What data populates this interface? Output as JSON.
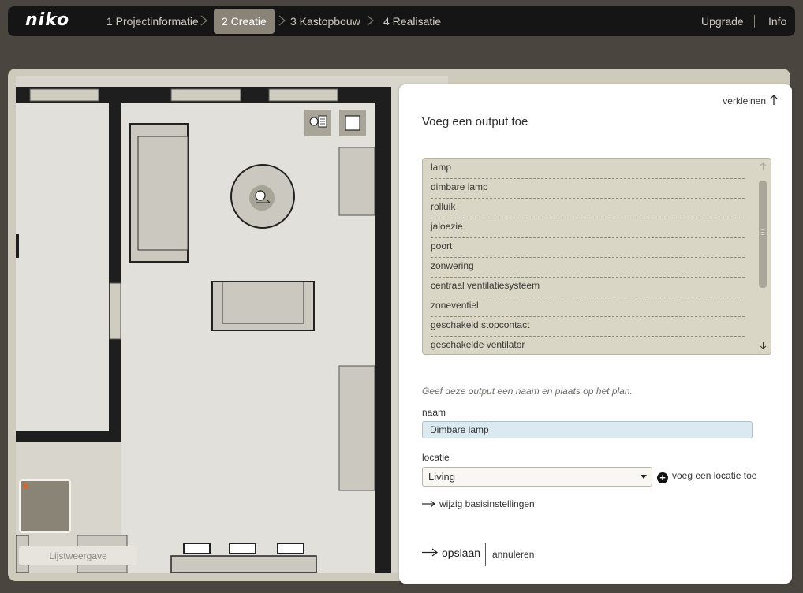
{
  "brand": {
    "logo": "niko"
  },
  "steps": [
    {
      "label": "1 Projectinformatie",
      "active": false
    },
    {
      "label": "2 Creatie",
      "active": true
    },
    {
      "label": "3 Kastopbouw",
      "active": false
    },
    {
      "label": "4 Realisatie",
      "active": false
    }
  ],
  "topnav": {
    "upgrade": "Upgrade",
    "info": "Info"
  },
  "plan": {
    "list_view_button": "Lijstweergave"
  },
  "panel": {
    "collapse_label": "verkleinen",
    "title": "Voeg een output toe",
    "output_types": [
      "lamp",
      "dimbare lamp",
      "rolluik",
      "jaloezie",
      "poort",
      "zonwering",
      "centraal ventilatiesysteem",
      "zoneventiel",
      "geschakeld stopcontact",
      "geschakelde ventilator"
    ],
    "hint": "Geef deze output een naam en plaats op het plan.",
    "name_label": "naam",
    "name_value": "Dimbare lamp",
    "location_label": "locatie",
    "location_value": "Living",
    "add_location": "voeg een locatie toe",
    "change_settings": "wijzig basisinstellingen",
    "save": "opslaan",
    "cancel": "annuleren"
  },
  "colors": {
    "accent_step": "#8a8478",
    "panel_list": "#d9d6c5",
    "name_field": "#dbeaf1",
    "topbar": "#151515"
  }
}
